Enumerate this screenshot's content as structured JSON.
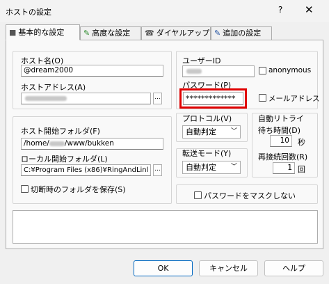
{
  "window": {
    "title": "ホストの設定",
    "help": "?",
    "close": "✕"
  },
  "tabs": [
    {
      "label": "基本的な設定",
      "icon": "■"
    },
    {
      "label": "高度な設定",
      "icon": "✎"
    },
    {
      "label": "ダイヤルアップ",
      "icon": "☎"
    },
    {
      "label": "追加の設定",
      "icon": "✎"
    }
  ],
  "host": {
    "name_label": "ホスト名(O)",
    "name_value": "@dream2000",
    "address_label": "ホストアドレス(A)",
    "browse": "..."
  },
  "user": {
    "id_label": "ユーザーID",
    "anonymous_label": "anonymous",
    "password_label": "パスワード(P)",
    "password_value": "*************",
    "show_password_label": "メールアドレス"
  },
  "protocol": {
    "label": "プロトコル(V)",
    "value": "自動判定"
  },
  "transfer": {
    "label": "転送モード(Y)",
    "value": "自動判定"
  },
  "retry": {
    "label": "自動リトライ",
    "wait_label": "待ち時間(D)",
    "wait_value": "10",
    "wait_unit": "秒",
    "count_label": "再接続回数(R)",
    "count_value": "1",
    "count_unit": "回"
  },
  "mask": {
    "label": "パスワードをマスクしない"
  },
  "folders": {
    "host_label": "ホスト開始フォルダ(F)",
    "host_value_a": "/home/",
    "host_value_b": "/www/bukken",
    "local_label": "ローカル開始フォルダ(L)",
    "local_value": "C:¥Program Files (x86)¥RingAndLinl",
    "browse": "...",
    "save_label": "切断時のフォルダを保存(S)"
  },
  "buttons": {
    "ok": "OK",
    "cancel": "キャンセル",
    "help": "ヘルプ"
  }
}
